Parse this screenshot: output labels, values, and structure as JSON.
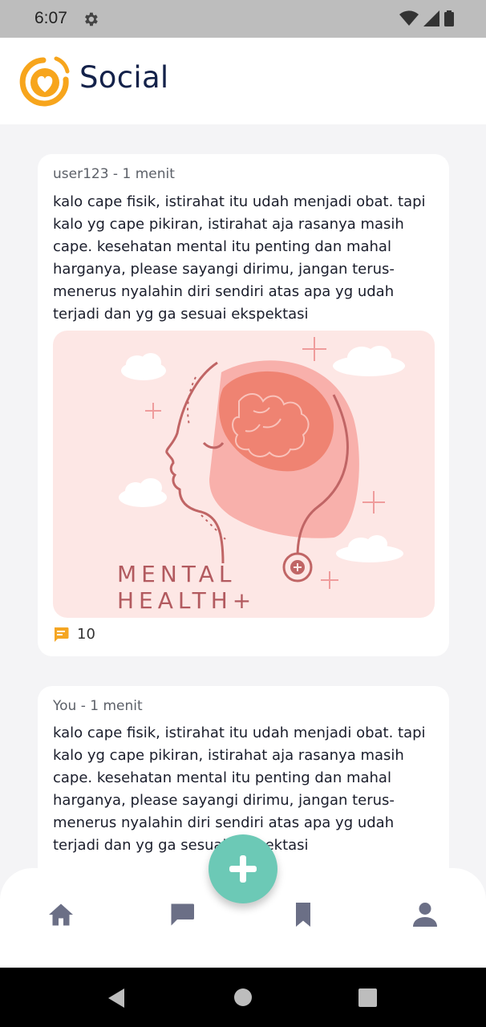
{
  "status_bar": {
    "time": "6:07"
  },
  "header": {
    "title": "Social"
  },
  "posts": [
    {
      "meta": "user123 - 1 menit",
      "text": "kalo cape fisik, istirahat itu udah menjadi obat. tapi kalo yg cape pikiran, istirahat aja rasanya masih cape. kesehatan mental itu penting dan mahal harganya, please sayangi dirimu, jangan terus-menerus nyalahin diri sendiri atas apa yg udah terjadi dan yg ga sesuai ekspektasi",
      "image": {
        "line1": "MENTAL",
        "line2": "HEALTH+"
      },
      "comment_count": "10"
    },
    {
      "meta": "You - 1 menit",
      "text": "kalo cape fisik, istirahat itu udah menjadi obat. tapi kalo yg cape pikiran, istirahat aja rasanya masih cape. kesehatan mental itu penting dan mahal harganya, please sayangi dirimu, jangan terus-menerus nyalahin diri sendiri atas apa yg udah terjadi dan yg ga sesuai ekspektasi"
    }
  ],
  "bottom_nav": {
    "items": [
      {
        "icon": "home-icon"
      },
      {
        "icon": "chat-icon"
      },
      {
        "icon": "bookmark-icon"
      },
      {
        "icon": "profile-icon"
      }
    ],
    "fab_icon": "plus-icon"
  },
  "colors": {
    "accent": "#6cc9b6",
    "logo_orange": "#f7a51c",
    "nav_icon": "#6b6f86",
    "comment_icon": "#f5a623"
  }
}
